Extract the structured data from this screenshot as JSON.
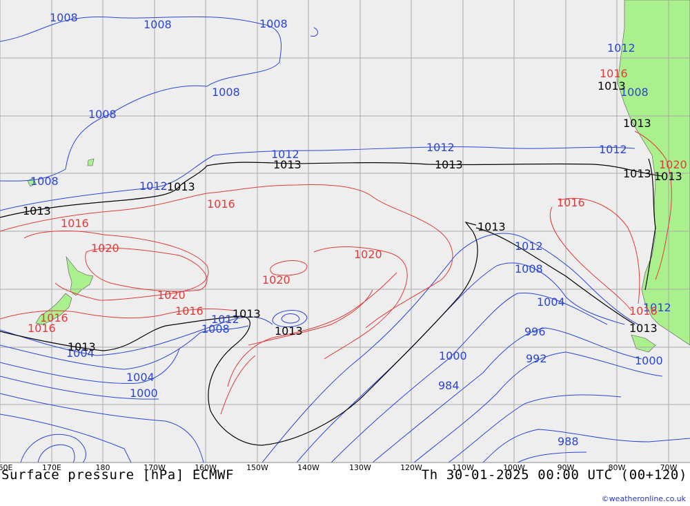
{
  "map": {
    "colors": {
      "ocean": "#eeeeee",
      "land": "#aaf08c",
      "grid": "#a9a9a9",
      "blue": "#2a44d6",
      "black": "#000000",
      "red": "#e23a3a"
    },
    "x_ticks": [
      "60E",
      "170E",
      "180",
      "170W",
      "160W",
      "150W",
      "140W",
      "130W",
      "120W",
      "110W",
      "100W",
      "90W",
      "80W",
      "70W"
    ]
  },
  "isobar_labels": {
    "blue": [
      "1008",
      "1008",
      "1008",
      "1008",
      "1008",
      "1008",
      "1012",
      "1012",
      "1012",
      "1012",
      "1012",
      "1012",
      "1008",
      "1004",
      "1000",
      "1004",
      "1008",
      "1004",
      "996",
      "992",
      "1000",
      "1000",
      "984",
      "988",
      "1008",
      "1012",
      "1012"
    ],
    "black": [
      "1013",
      "1013",
      "1013",
      "1013",
      "1013",
      "1013",
      "1013",
      "1013",
      "1013",
      "1013",
      "1013",
      "1013",
      "1013"
    ],
    "red": [
      "1016",
      "1016",
      "1016",
      "1016",
      "1016",
      "1020",
      "1020",
      "1020",
      "1020",
      "1016",
      "1016",
      "1016",
      "1020"
    ]
  },
  "footer": {
    "left": "Surface pressure [hPa] ECMWF",
    "right": "Th 30-01-2025 00:00 UTC (00+120)",
    "credit": "©weatheronline.co.uk"
  }
}
